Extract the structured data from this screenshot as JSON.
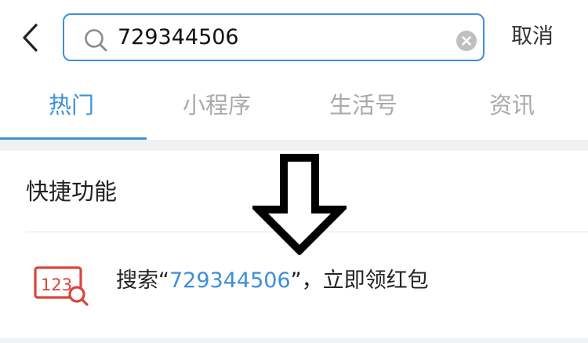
{
  "header": {
    "search_value": "729344506",
    "cancel_label": "取消"
  },
  "tabs": [
    {
      "label": "热门",
      "active": true
    },
    {
      "label": "小程序",
      "active": false
    },
    {
      "label": "生活号",
      "active": false
    },
    {
      "label": "资讯",
      "active": false
    }
  ],
  "quick_functions": {
    "title": "快捷功能",
    "item": {
      "icon_text": "123",
      "prefix": "搜索“",
      "query": "729344506",
      "suffix": "”，立即领红包"
    }
  },
  "colors": {
    "accent": "#3d8fd9",
    "icon_red": "#d9453a",
    "tab_inactive": "#a9a9a9"
  },
  "icons": [
    "back-arrow-icon",
    "search-icon",
    "clear-icon",
    "number-search-icon",
    "down-arrow-icon"
  ]
}
